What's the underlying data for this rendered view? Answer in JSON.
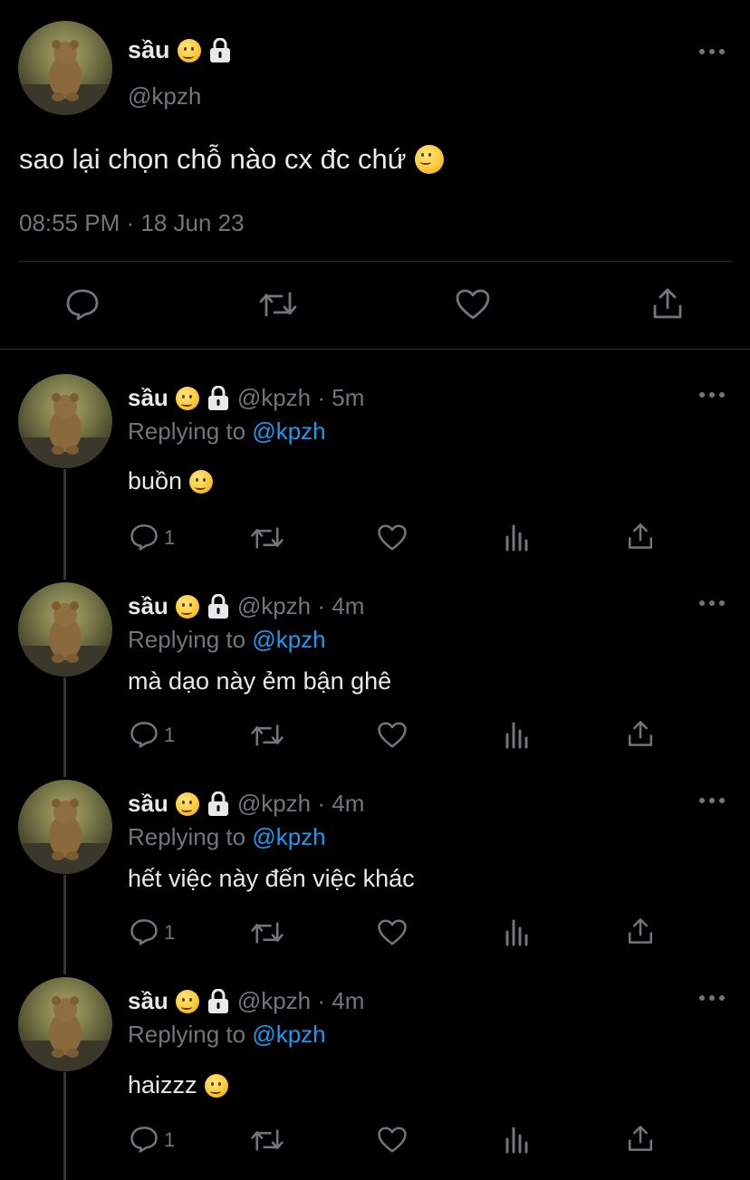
{
  "main_tweet": {
    "display_name": "sầu",
    "handle": "@kpzh",
    "text": "sao lại chọn chỗ nào cx đc chứ",
    "timestamp": "08:55 PM · 18 Jun 23",
    "emoji": "melting-face",
    "badge_icon": "lock-icon"
  },
  "replies": [
    {
      "display_name": "sầu",
      "meta": "@kpzh · 5m",
      "replying_prefix": "Replying to",
      "replying_to": "@kpzh",
      "text": "buồn",
      "reply_count": "1",
      "has_emoji": true
    },
    {
      "display_name": "sầu",
      "meta": "@kpzh · 4m",
      "replying_prefix": "Replying to",
      "replying_to": "@kpzh",
      "text": "mà dạo này ẻm bận ghê",
      "reply_count": "1",
      "has_emoji": false
    },
    {
      "display_name": "sầu",
      "meta": "@kpzh · 4m",
      "replying_prefix": "Replying to",
      "replying_to": "@kpzh",
      "text": "hết việc này đến việc khác",
      "reply_count": "1",
      "has_emoji": false
    },
    {
      "display_name": "sầu",
      "meta": "@kpzh · 4m",
      "replying_prefix": "Replying to",
      "replying_to": "@kpzh",
      "text": "haizzz",
      "reply_count": "1",
      "has_emoji": true
    }
  ],
  "colors": {
    "background": "#000000",
    "text": "#e7e9ea",
    "muted": "#71767b",
    "link": "#1d9bf0",
    "divider": "#2f3336"
  }
}
